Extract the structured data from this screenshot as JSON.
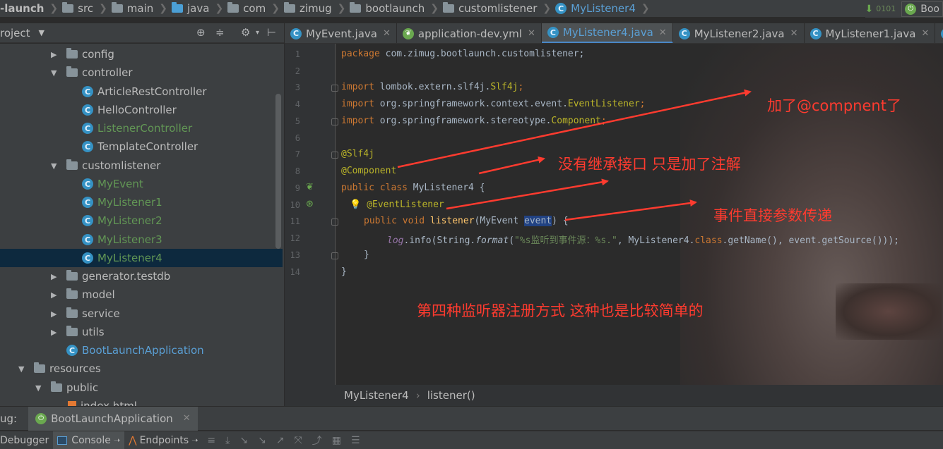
{
  "navbar": {
    "crumbs": [
      "-launch",
      "src",
      "main",
      "java",
      "com",
      "zimug",
      "bootlaunch",
      "customlistener",
      "MyListener4"
    ],
    "vcs_label": "0101",
    "run_config": "Boo"
  },
  "project": {
    "header_label": "roject"
  },
  "tree": {
    "items": [
      {
        "label": "config",
        "kind": "folder",
        "arrow": "▶"
      },
      {
        "label": "controller",
        "kind": "folder",
        "arrow": "▼"
      },
      {
        "label": "ArticleRestController",
        "kind": "class"
      },
      {
        "label": "HelloController",
        "kind": "class"
      },
      {
        "label": "ListenerController",
        "kind": "class",
        "green": true
      },
      {
        "label": "TemplateController",
        "kind": "class"
      },
      {
        "label": "customlistener",
        "kind": "folder",
        "arrow": "▼"
      },
      {
        "label": "MyEvent",
        "kind": "class",
        "green": true
      },
      {
        "label": "MyListener1",
        "kind": "class",
        "green": true
      },
      {
        "label": "MyListener2",
        "kind": "class",
        "green": true
      },
      {
        "label": "MyListener3",
        "kind": "class",
        "green": true
      },
      {
        "label": "MyListener4",
        "kind": "class",
        "green": true,
        "selected": true
      },
      {
        "label": "generator.testdb",
        "kind": "folder",
        "arrow": "▶"
      },
      {
        "label": "model",
        "kind": "folder",
        "arrow": "▶"
      },
      {
        "label": "service",
        "kind": "folder",
        "arrow": "▶"
      },
      {
        "label": "utils",
        "kind": "folder",
        "arrow": "▶"
      },
      {
        "label": "BootLaunchApplication",
        "kind": "spring",
        "blue": true
      },
      {
        "label": "resources",
        "kind": "folder",
        "arrow": "▼"
      },
      {
        "label": "public",
        "kind": "folder",
        "arrow": "▼"
      },
      {
        "label": "index.html",
        "kind": "file"
      }
    ]
  },
  "tabs": [
    {
      "label": "MyEvent.java",
      "icon": "class-icon"
    },
    {
      "label": "application-dev.yml",
      "icon": "spring-leaf-icon"
    },
    {
      "label": "MyListener4.java",
      "icon": "class-icon",
      "active": true
    },
    {
      "label": "MyListener2.java",
      "icon": "class-icon"
    },
    {
      "label": "MyListener1.java",
      "icon": "class-icon"
    }
  ],
  "code": {
    "line_numbers": [
      "1",
      "2",
      "3",
      "4",
      "5",
      "6",
      "7",
      "8",
      "9",
      "10",
      "11",
      "12",
      "13",
      "14"
    ],
    "l1_kw": "package",
    "l1_rest": " com.zimug.bootlaunch.customlistener;",
    "l3_kw": "import",
    "l3_pkg": " lombok.extern.slf4j.",
    "l3_cls": "Slf4j",
    "l3_end": ";",
    "l4_kw": "import",
    "l4_pkg": " org.springframework.context.event.",
    "l4_cls": "EventListener",
    "l4_end": ";",
    "l5_kw": "import",
    "l5_pkg": " org.springframework.stereotype.",
    "l5_cls": "Component",
    "l5_end": ";",
    "l7_an": "@Slf4j",
    "l8_an": "@Component",
    "l9_kw": "public class",
    "l9_rest": " MyListener4 {",
    "l10_an": "@EventListener",
    "l11_kw": "public void",
    "l11_fn": " listener",
    "l11_a": "(MyEvent ",
    "l11_sel": "event",
    "l11_b": ") {",
    "l12_log": "log",
    "l12_a": ".info(String.",
    "l12_fmt": "format",
    "l12_b": "(",
    "l12_str": "\"%s监听到事件源：%s.\"",
    "l12_c": ", MyListener4.",
    "l12_cls": "class",
    "l12_d": ".getName(), ",
    "l12_e": "event",
    "l12_f": ".getSource()));",
    "l13": "}",
    "l14": "}"
  },
  "annotations": {
    "a1": "加了@compnent了",
    "a2": "没有继承接口   只是加了注解",
    "a3": "事件直接参数传递",
    "a4": "第四种监听器注册方式    这种也是比较简单的"
  },
  "annotation_color": "#ff3b2f",
  "breadcrumb": {
    "cls": "MyListener4",
    "method": "listener()"
  },
  "debug": {
    "label": "ug:",
    "config": "BootLaunchApplication",
    "tabs": [
      "Debugger",
      "Console",
      "Endpoints"
    ]
  }
}
